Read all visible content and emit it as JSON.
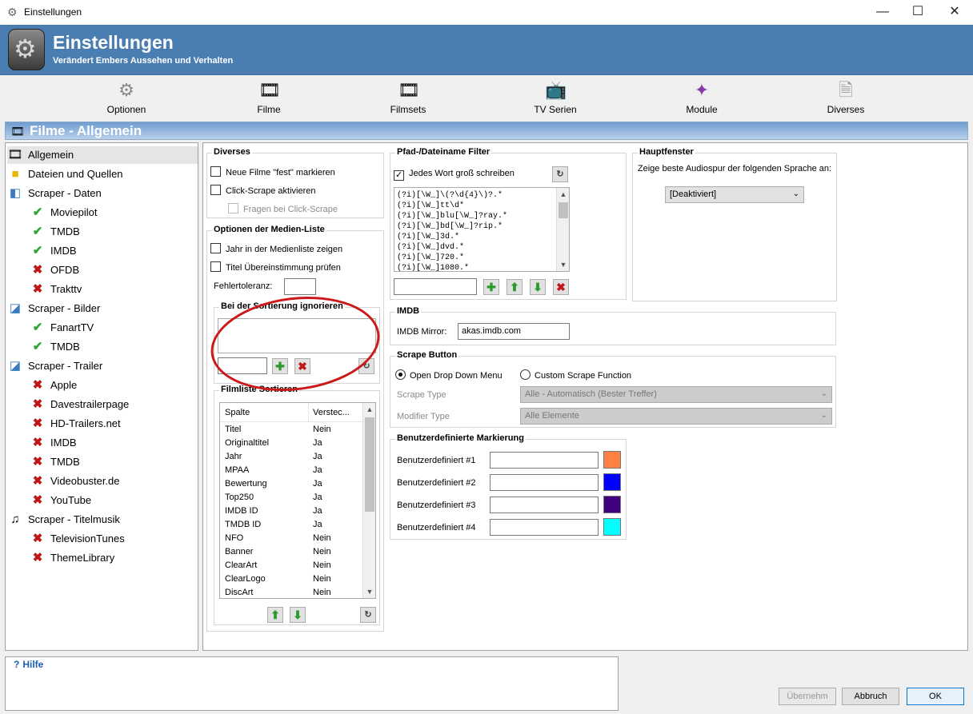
{
  "window": {
    "title": "Einstellungen",
    "minimize": "—",
    "maximize": "☐",
    "close": "✕"
  },
  "header": {
    "title": "Einstellungen",
    "subtitle": "Verändert Embers Aussehen und Verhalten"
  },
  "toolbar": [
    {
      "label": "Optionen",
      "icon": "gear-icon"
    },
    {
      "label": "Filme",
      "icon": "film-icon"
    },
    {
      "label": "Filmsets",
      "icon": "filmsets-icon"
    },
    {
      "label": "TV Serien",
      "icon": "tv-icon"
    },
    {
      "label": "Module",
      "icon": "puzzle-icon"
    },
    {
      "label": "Diverses",
      "icon": "document-icon"
    }
  ],
  "section_title": "Filme - Allgemein",
  "tree": [
    {
      "label": "Allgemein",
      "icon": "film-icon",
      "level": 0,
      "selected": true
    },
    {
      "label": "Dateien und Quellen",
      "icon": "folder-icon",
      "level": 0
    },
    {
      "label": "Scraper - Daten",
      "icon": "scraper-icon",
      "level": 0
    },
    {
      "label": "Moviepilot",
      "icon": "check-icon",
      "level": 1
    },
    {
      "label": "TMDB",
      "icon": "check-icon",
      "level": 1
    },
    {
      "label": "IMDB",
      "icon": "check-icon",
      "level": 1
    },
    {
      "label": "OFDB",
      "icon": "cross-icon",
      "level": 1
    },
    {
      "label": "Trakttv",
      "icon": "cross-icon",
      "level": 1
    },
    {
      "label": "Scraper - Bilder",
      "icon": "image-icon",
      "level": 0
    },
    {
      "label": "FanartTV",
      "icon": "check-icon",
      "level": 1
    },
    {
      "label": "TMDB",
      "icon": "check-icon",
      "level": 1
    },
    {
      "label": "Scraper - Trailer",
      "icon": "image-icon",
      "level": 0
    },
    {
      "label": "Apple",
      "icon": "cross-icon",
      "level": 1
    },
    {
      "label": "Davestrailerpage",
      "icon": "cross-icon",
      "level": 1
    },
    {
      "label": "HD-Trailers.net",
      "icon": "cross-icon",
      "level": 1
    },
    {
      "label": "IMDB",
      "icon": "cross-icon",
      "level": 1
    },
    {
      "label": "TMDB",
      "icon": "cross-icon",
      "level": 1
    },
    {
      "label": "Videobuster.de",
      "icon": "cross-icon",
      "level": 1
    },
    {
      "label": "YouTube",
      "icon": "cross-icon",
      "level": 1
    },
    {
      "label": "Scraper - Titelmusik",
      "icon": "music-icon",
      "level": 0
    },
    {
      "label": "TelevisionTunes",
      "icon": "cross-icon",
      "level": 1
    },
    {
      "label": "ThemeLibrary",
      "icon": "cross-icon",
      "level": 1
    }
  ],
  "diverses": {
    "title": "Diverses",
    "neue_filme": "Neue Filme \"fest\" markieren",
    "click_scrape": "Click-Scrape aktivieren",
    "fragen": "Fragen bei Click-Scrape"
  },
  "medienliste": {
    "title": "Optionen der Medien-Liste",
    "jahr": "Jahr in der Medienliste zeigen",
    "titel": "Titel Übereinstimmung prüfen",
    "fehlertoleranz": "Fehlertoleranz:",
    "sortierung_title": "Bei der Sortierung ignorieren"
  },
  "filmliste": {
    "title": "Filmliste Sortieren",
    "columns": [
      "Spalte",
      "Versteс..."
    ],
    "rows": [
      [
        "Titel",
        "Nein"
      ],
      [
        "Originaltitel",
        "Ja"
      ],
      [
        "Jahr",
        "Ja"
      ],
      [
        "MPAA",
        "Ja"
      ],
      [
        "Bewertung",
        "Ja"
      ],
      [
        "Top250",
        "Ja"
      ],
      [
        "IMDB ID",
        "Ja"
      ],
      [
        "TMDB ID",
        "Ja"
      ],
      [
        "NFO",
        "Nein"
      ],
      [
        "Banner",
        "Nein"
      ],
      [
        "ClearArt",
        "Nein"
      ],
      [
        "ClearLogo",
        "Nein"
      ],
      [
        "DiscArt",
        "Nein"
      ]
    ]
  },
  "pfad": {
    "title": "Pfad-/Dateiname Filter",
    "jedes_wort": "Jedes Wort groß schreiben",
    "filters": [
      "(?i)[\\W_]\\(?\\d{4}\\)?.*",
      "(?i)[\\W_]tt\\d*",
      "(?i)[\\W_]blu[\\W_]?ray.*",
      "(?i)[\\W_]bd[\\W_]?rip.*",
      "(?i)[\\W_]3d.*",
      "(?i)[\\W_]dvd.*",
      "(?i)[\\W_]720.*",
      "(?i)[\\W_]1080.*"
    ]
  },
  "hauptfenster": {
    "title": "Hauptfenster",
    "label": "Zeige beste Audiospur der folgenden Sprache an:",
    "value": "[Deaktiviert]"
  },
  "imdb": {
    "title": "IMDB",
    "mirror_label": "IMDB Mirror:",
    "mirror_value": "akas.imdb.com"
  },
  "scrape_button": {
    "title": "Scrape Button",
    "opt1": "Open Drop Down Menu",
    "opt2": "Custom Scrape Function",
    "type_label": "Scrape Type",
    "type_value": "Alle - Automatisch (Bester Treffer)",
    "modifier_label": "Modifier Type",
    "modifier_value": "Alle Elemente"
  },
  "markierung": {
    "title": "Benutzerdefinierte Markierung",
    "items": [
      {
        "label": "Benutzerdefiniert #1",
        "color": "#ff8040"
      },
      {
        "label": "Benutzerdefiniert #2",
        "color": "#0000ff"
      },
      {
        "label": "Benutzerdefiniert #3",
        "color": "#400080"
      },
      {
        "label": "Benutzerdefiniert #4",
        "color": "#00ffff"
      }
    ]
  },
  "hilfe": {
    "title": "Hilfe"
  },
  "buttons": {
    "apply": "Übernehm",
    "cancel": "Abbruch",
    "ok": "OK"
  }
}
